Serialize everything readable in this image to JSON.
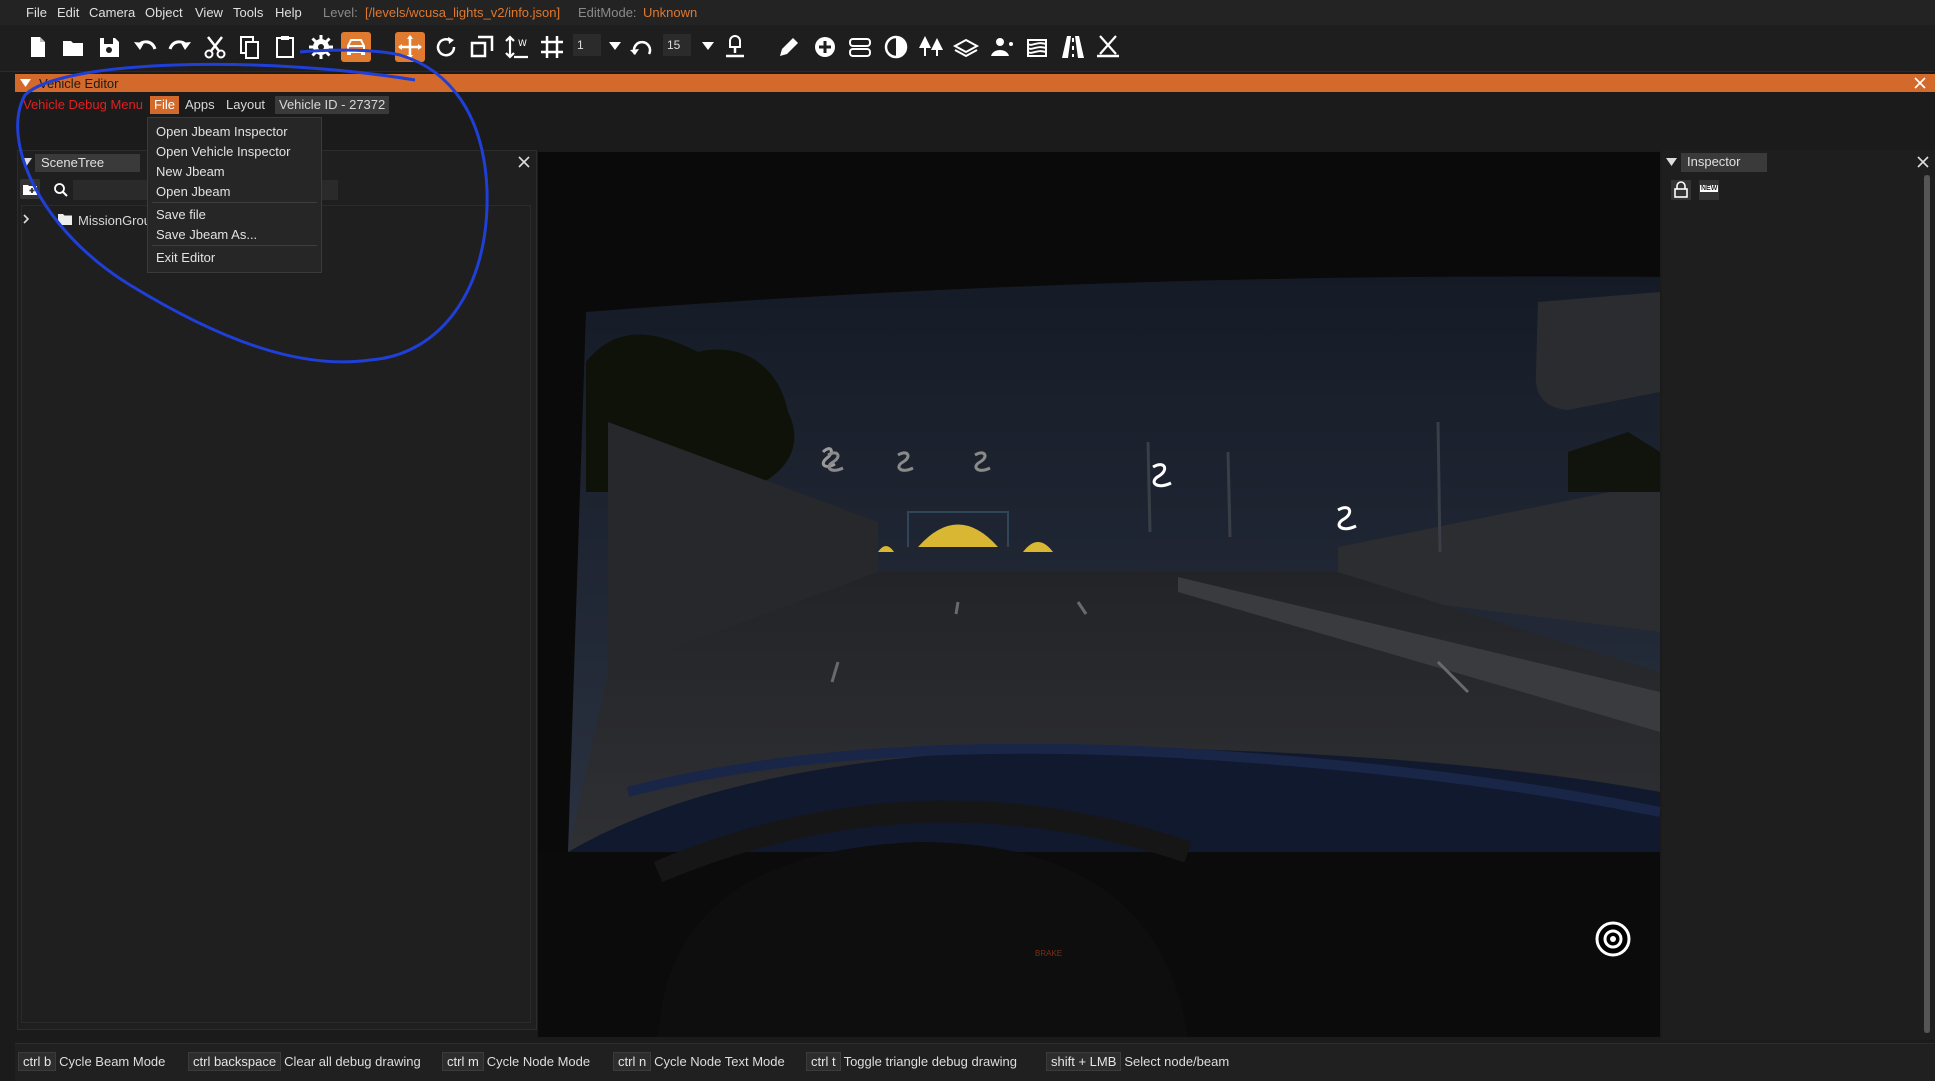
{
  "menubar": {
    "items": [
      "File",
      "Edit",
      "Camera",
      "Object",
      "View",
      "Tools",
      "Help"
    ],
    "level_label": "Level:",
    "level_value": "[/levels/wcusa_lights_v2/info.json]",
    "editmode_label": "EditMode:",
    "editmode_value": "Unknown"
  },
  "toolbar": {
    "grid_value": "1",
    "rotate_value": "15"
  },
  "vehicle_editor": {
    "title": "Vehicle Editor",
    "menu": {
      "debug": "Vehicle Debug Menu",
      "file": "File",
      "apps": "Apps",
      "layout": "Layout",
      "vehicle_id": "Vehicle ID - 27372"
    },
    "file_menu": [
      "Open Jbeam Inspector",
      "Open Vehicle Inspector",
      "New Jbeam",
      "Open Jbeam",
      "Save file",
      "Save Jbeam As...",
      "Exit Editor"
    ]
  },
  "scenetree": {
    "title": "SceneTree",
    "root_item": "MissionGrou"
  },
  "inspector": {
    "title": "Inspector",
    "new_label": "NEW"
  },
  "viewport": {
    "dash_label": "BRAKE"
  },
  "shortcuts": [
    {
      "key": "ctrl b",
      "desc": "Cycle Beam Mode"
    },
    {
      "key": "ctrl backspace",
      "desc": "Clear all debug drawing"
    },
    {
      "key": "ctrl m",
      "desc": "Cycle Node Mode"
    },
    {
      "key": "ctrl n",
      "desc": "Cycle Node Text Mode"
    },
    {
      "key": "ctrl t",
      "desc": "Toggle triangle debug drawing"
    },
    {
      "key": "shift + LMB",
      "desc": "Select node/beam"
    }
  ],
  "colors": {
    "accent": "#e07a2e",
    "level_path": "#e0782e",
    "debug_menu": "#e02020",
    "annotation": "#1f3fd6"
  }
}
